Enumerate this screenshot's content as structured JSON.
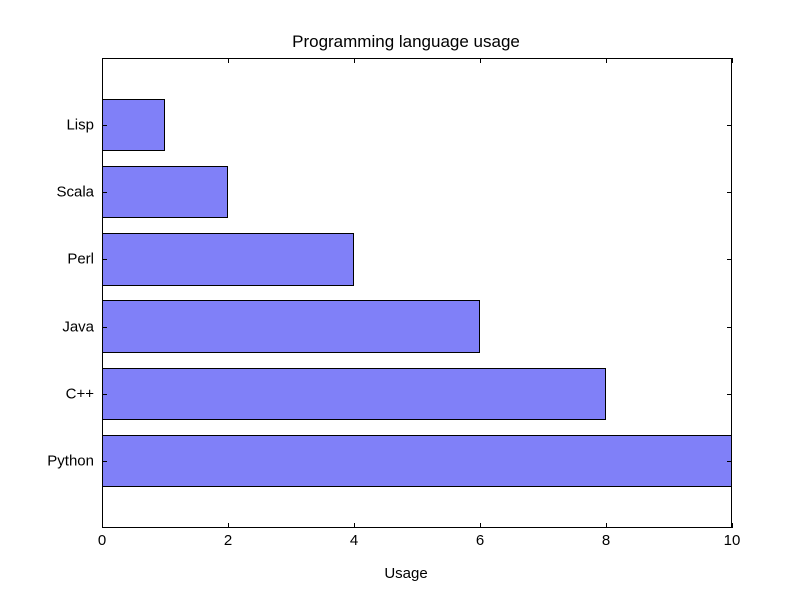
{
  "chart_data": {
    "type": "bar",
    "orientation": "horizontal",
    "categories": [
      "Python",
      "C++",
      "Java",
      "Perl",
      "Scala",
      "Lisp"
    ],
    "values": [
      10,
      8,
      6,
      4,
      2,
      1
    ],
    "title": "Programming language usage",
    "xlabel": "Usage",
    "ylabel": "",
    "xlim": [
      0,
      10
    ],
    "xticks": [
      0,
      2,
      4,
      6,
      8,
      10
    ],
    "bar_color": "#8080f8"
  }
}
